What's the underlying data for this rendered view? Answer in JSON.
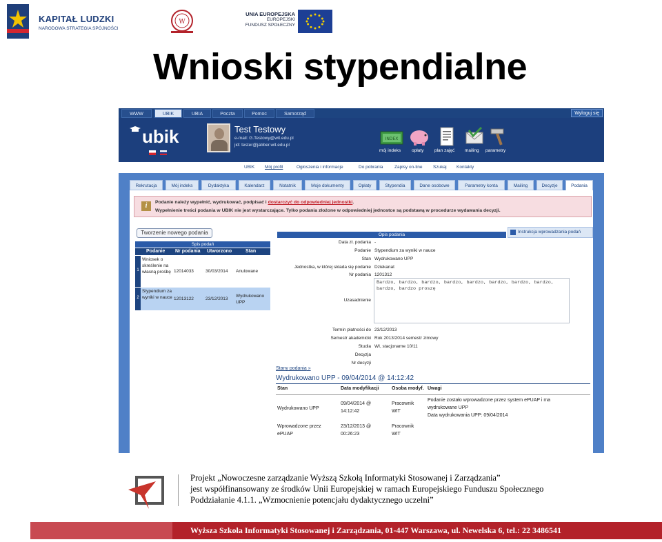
{
  "logos": {
    "kapital_title": "KAPITAŁ LUDZKI",
    "kapital_sub": "NARODOWA STRATEGIA SPÓJNOŚCI",
    "eu_line1": "UNIA EUROPEJSKA",
    "eu_line2": "EUROPEJSKI",
    "eu_line3": "FUNDUSZ SPOŁECZNY"
  },
  "slide_title": "Wnioski stypendialne",
  "app": {
    "top_tabs": [
      "WWW",
      "UBIK",
      "UBIA",
      "Poczta",
      "Pomoc",
      "Samorząd"
    ],
    "logout": "Wyloguj się",
    "logo": "ubik",
    "user": {
      "name": "Test Testowy",
      "email": "e-mail: G.Testowy@wit.edu.pl",
      "jid": "jid: tester@jabber.wit.edu.pl"
    },
    "header_icons": [
      {
        "icon": "money-icon",
        "label": "mój indeks"
      },
      {
        "icon": "piggy-bank-icon",
        "label": "opłaty"
      },
      {
        "icon": "document-icon",
        "label": "plan zajęć"
      },
      {
        "icon": "mailing-icon",
        "label": "mailing"
      },
      {
        "icon": "hammer-icon",
        "label": "parametry"
      }
    ],
    "sub_nav": [
      "UBIK",
      "Mój profil",
      "Ogłoszenia i informacje",
      "Do pobrania",
      "Zapisy on-line",
      "Szukaj",
      "Kontakty"
    ],
    "tabs": [
      "Rekrutacja",
      "Mój indeks",
      "Dydaktyka",
      "Kalendarz",
      "Notatnik",
      "Moje dokumenty",
      "Opłaty",
      "Stypendia",
      "Dane osobowe",
      "Parametry konta",
      "Mailing",
      "Decyzje",
      "Podania"
    ],
    "alert": {
      "line1_a": "Podanie należy wypełnić, wydrukować, podpisać i ",
      "line1_link": "dostarczyć do odpowiedniej jednostki",
      "line1_b": ".",
      "line2": "Wypełnienie treści podania w UBIK nie jest wystarczające. Tylko podania złożone w odpowiedniej jednostce są podstawą w procedurze wydawania decyzji."
    },
    "new_button": "Tworzenie nowego podania",
    "list": {
      "title": "Spis podań",
      "columns": [
        "Podanie",
        "Nr podania",
        "Utworzono",
        "Stan"
      ],
      "rows": [
        {
          "num": "1",
          "podanie": "Wniosek o skreślenie na własną prośbę",
          "nr": "12014033",
          "date": "30/03/2014",
          "stan": "Anulowane"
        },
        {
          "num": "2",
          "podanie": "Stypendium za wyniki w nauce",
          "nr": "12013122",
          "date": "23/12/2013",
          "stan": "Wydrukowano UPP"
        }
      ]
    },
    "details": {
      "title": "Opis podania",
      "instruction": "Instrukcja wprowadzania podań",
      "fields": [
        {
          "label": "Data zł. podania",
          "value": "-"
        },
        {
          "label": "Podanie",
          "value": "Stypendium za wyniki w nauce"
        },
        {
          "label": "Stan",
          "value": "Wydrukowano UPP"
        },
        {
          "label": "Jednostka, w której składa się podanie",
          "value": "Dziekanat"
        },
        {
          "label": "Nr podania",
          "value": "1201312"
        }
      ],
      "justification_label": "Uzasadnienie",
      "justification_text": "Bardzo, bardzo, bardzo, bardzo, bardzo, bardzo, bardzo, bardzo, bardzo, bardzo  proszę",
      "fields2": [
        {
          "label": "Termin płatności do",
          "value": "23/12/2013"
        },
        {
          "label": "Semestr akademicki",
          "value": "Rok 2013/2014 semestr zimowy"
        },
        {
          "label": "Studia",
          "value": "WI, stacjonarne 10/11"
        },
        {
          "label": "Decyzja",
          "value": ""
        },
        {
          "label": "Nr decyzji",
          "value": ""
        }
      ]
    },
    "states": {
      "link": "Stany podania",
      "title": "Wydrukowano UPP - 09/04/2014 @ 14:12:42",
      "columns": [
        "Stan",
        "Data modyfikacji",
        "Osoba modyf.",
        "Uwagi"
      ],
      "rows": [
        {
          "stan": "Wydrukowano UPP",
          "date1": "09/04/2014 @",
          "date2": "14:12:42",
          "person1": "Pracownik",
          "person2": "WIT",
          "notes1": "Podanie zostało wprowadzone przez system ePUAP i ma",
          "notes2": "wydrukowane UPP",
          "notes3": "Data wydrukowania UPP: 09/04/2014"
        },
        {
          "stan": "Wprowadzone przez",
          "stan2": "ePUAP",
          "date1": "23/12/2013 @",
          "date2": "00:26:23",
          "person1": "Pracownik",
          "person2": "WIT",
          "notes1": "",
          "notes2": "",
          "notes3": ""
        }
      ]
    }
  },
  "footer": {
    "line1": "Projekt „Nowoczesne zarządzanie Wyższą Szkołą Informatyki Stosowanej i Zarządzania”",
    "line2": "jest współfinansowany ze środków Unii Europejskiej w ramach Europejskiego Funduszu Społecznego",
    "line3": "Poddziałanie 4.1.1. „Wzmocnienie potencjału dydaktycznego uczelni”",
    "bar": "Wyższa Szkoła Informatyki Stosowanej i Zarządzania, 01-447 Warszawa, ul. Newelska 6, tel.: 22 3486541"
  },
  "colors": {
    "header_navy": "#1c3f7d",
    "app_blue": "#4f80c7",
    "alert_pink": "#f7dde1",
    "footer_red": "#b3222a"
  }
}
